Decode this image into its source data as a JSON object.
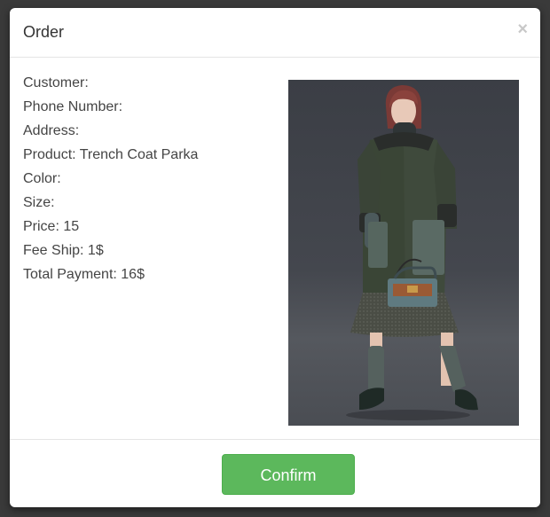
{
  "modal": {
    "title": "Order",
    "close_symbol": "×"
  },
  "order": {
    "customer": "Customer:",
    "phone": "Phone Number:",
    "address": "Address:",
    "product": "Product: Trench Coat Parka",
    "color": "Color:",
    "size": "Size:",
    "price": "Price: 15",
    "fee_ship": "Fee Ship: 1$",
    "total": "Total Payment: 16$"
  },
  "image": {
    "subject": "model-wearing-green-coat-with-handbag"
  },
  "footer": {
    "confirm_label": "Confirm"
  },
  "colors": {
    "confirm_bg": "#5cb85c",
    "backdrop": "#3a3a3a"
  }
}
